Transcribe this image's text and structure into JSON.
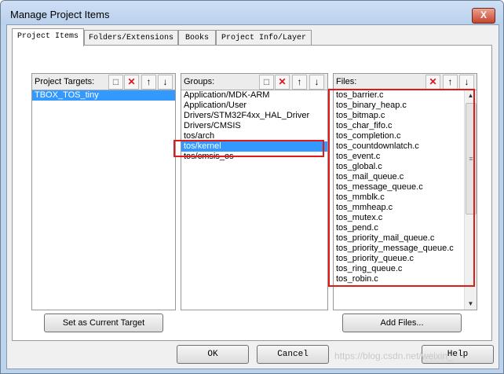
{
  "window": {
    "title": "Manage Project Items",
    "close_label": "X"
  },
  "tabs": [
    {
      "label": "Project Items",
      "active": true
    },
    {
      "label": "Folders/Extensions",
      "active": false
    },
    {
      "label": "Books",
      "active": false
    },
    {
      "label": "Project Info/Layer",
      "active": false
    }
  ],
  "targets": {
    "label": "Project Targets:",
    "items": [
      "TBOX_TOS_tiny"
    ],
    "selected": 0,
    "tools": [
      "new-icon",
      "delete-icon",
      "move-up-icon",
      "move-down-icon"
    ],
    "button_label": "Set as Current Target"
  },
  "groups": {
    "label": "Groups:",
    "items": [
      "Application/MDK-ARM",
      "Application/User",
      "Drivers/STM32F4xx_HAL_Driver",
      "Drivers/CMSIS",
      "tos/arch",
      "tos/kernel",
      "tos/cmsis_os"
    ],
    "selected": 5,
    "tools": [
      "new-icon",
      "delete-icon",
      "move-up-icon",
      "move-down-icon"
    ]
  },
  "files": {
    "label": "Files:",
    "items": [
      "tos_barrier.c",
      "tos_binary_heap.c",
      "tos_bitmap.c",
      "tos_char_fifo.c",
      "tos_completion.c",
      "tos_countdownlatch.c",
      "tos_event.c",
      "tos_global.c",
      "tos_mail_queue.c",
      "tos_message_queue.c",
      "tos_mmblk.c",
      "tos_mmheap.c",
      "tos_mutex.c",
      "tos_pend.c",
      "tos_priority_mail_queue.c",
      "tos_priority_message_queue.c",
      "tos_priority_queue.c",
      "tos_ring_queue.c",
      "tos_robin.c"
    ],
    "tools": [
      "delete-icon",
      "move-up-icon",
      "move-down-icon"
    ],
    "button_label": "Add Files..."
  },
  "buttons": {
    "ok": "OK",
    "cancel": "Cancel",
    "help": "Help"
  },
  "watermark": "https://blog.csdn.net/weixin_",
  "colors": {
    "highlight_box": "#e0191b",
    "selection": "#3399ff"
  }
}
